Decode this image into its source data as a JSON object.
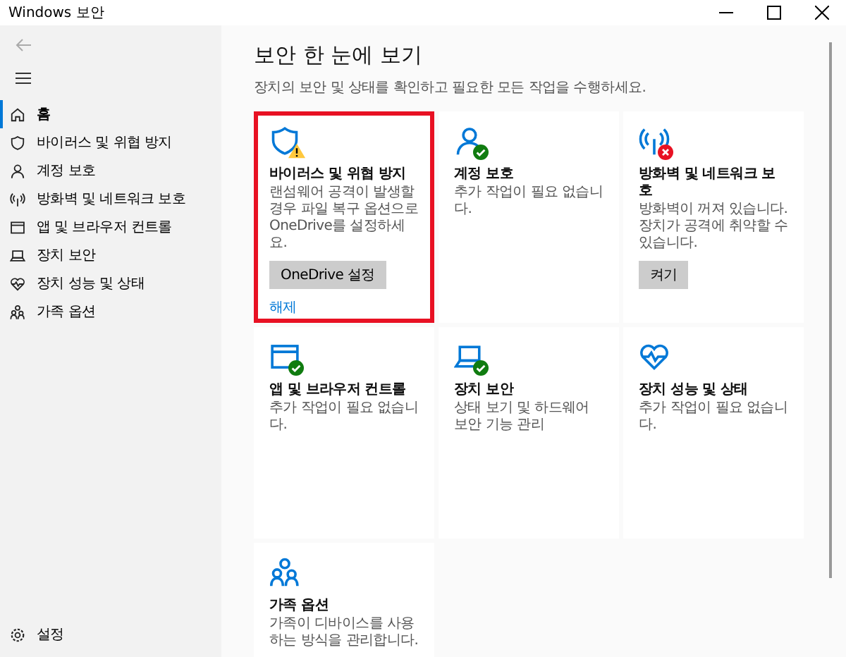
{
  "window": {
    "title": "Windows 보안"
  },
  "sidebar": {
    "items": [
      {
        "label": "홈",
        "kind": "home",
        "selected": true
      },
      {
        "label": "바이러스 및 위협 방지",
        "kind": "shield",
        "selected": false
      },
      {
        "label": "계정 보호",
        "kind": "person",
        "selected": false
      },
      {
        "label": "방화벽 및 네트워크 보호",
        "kind": "antenna",
        "selected": false
      },
      {
        "label": "앱 및 브라우저 컨트롤",
        "kind": "window",
        "selected": false
      },
      {
        "label": "장치 보안",
        "kind": "laptop",
        "selected": false
      },
      {
        "label": "장치 성능 및 상태",
        "kind": "heart",
        "selected": false
      },
      {
        "label": "가족 옵션",
        "kind": "family",
        "selected": false
      }
    ],
    "settings": {
      "label": "설정"
    }
  },
  "page": {
    "title": "보안 한 눈에 보기",
    "subtitle": "장치의 보안 및 상태를 확인하고 필요한 모든 작업을 수행하세요."
  },
  "cards": [
    {
      "title": "바이러스 및 위협 방지",
      "description": "랜섬웨어 공격이 발생할 경우 파일 복구 옵션으로 OneDrive를 설정하세요.",
      "kind": "shield",
      "badge": {
        "kind": "warning"
      },
      "button": "OneDrive 설정",
      "link": "해제",
      "highlighted": true
    },
    {
      "title": "계정 보호",
      "description": "추가 작업이 필요 없습니다.",
      "kind": "person",
      "badge": {
        "kind": "ok"
      },
      "highlighted": false
    },
    {
      "title": "방화벽 및 네트워크 보호",
      "description": "방화벽이 꺼져 있습니다. 장치가 공격에 취약할 수 있습니다.",
      "kind": "antenna",
      "badge": {
        "kind": "error"
      },
      "button": "켜기",
      "highlighted": false
    },
    {
      "title": "앱 및 브라우저 컨트롤",
      "description": "추가 작업이 필요 없습니다.",
      "kind": "window",
      "badge": {
        "kind": "ok"
      },
      "highlighted": false
    },
    {
      "title": "장치 보안",
      "description": "상태 보기 및 하드웨어 보안 기능 관리",
      "kind": "laptop",
      "badge": {
        "kind": "ok"
      },
      "highlighted": false
    },
    {
      "title": "장치 성능 및 상태",
      "description": "추가 작업이 필요 없습니다.",
      "kind": "heart",
      "highlighted": false
    },
    {
      "title": "가족 옵션",
      "description": "가족이 디바이스를 사용하는 방식을 관리합니다.",
      "kind": "family",
      "highlighted": false
    }
  ]
}
